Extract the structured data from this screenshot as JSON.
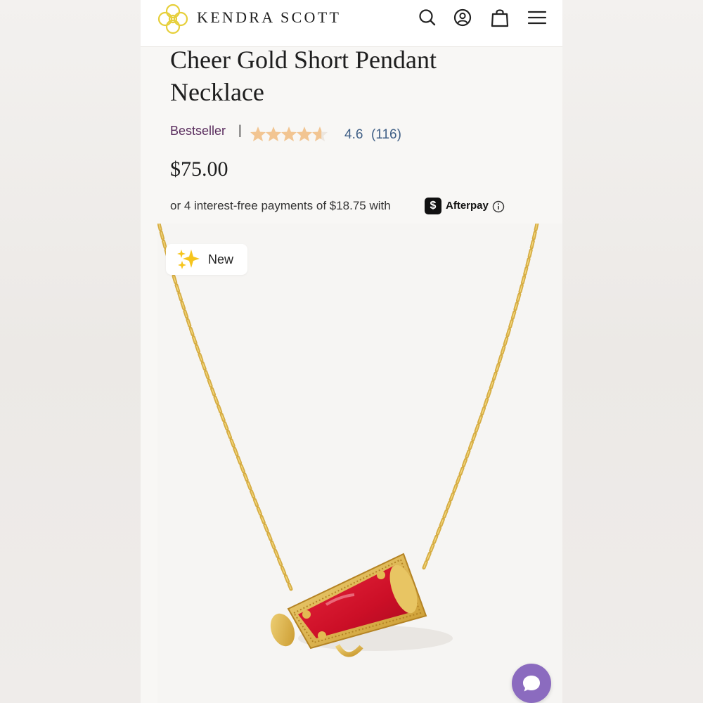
{
  "header": {
    "brand": "KENDRA SCOTT",
    "icons": [
      "search-icon",
      "account-icon",
      "shopping-bag-icon",
      "menu-icon"
    ]
  },
  "product": {
    "title": "Cheer Gold Short Pendant Necklace",
    "badge_bestseller": "Bestseller",
    "divider": "|",
    "rating": "4.6",
    "rating_value": 4.6,
    "reviews": "(116)",
    "price": "$75.00",
    "installments_text": "or 4 interest-free payments of $18.75 with",
    "afterpay_badge": "$",
    "afterpay_label": "Afterpay",
    "new_badge": "New"
  },
  "colors": {
    "brand_gold": "#e6cf3a",
    "bestseller": "#5a2d5e",
    "rating": "#3f5f86",
    "star": "#f2c592",
    "chat": "#8b6bbf",
    "pendant_red": "#d3122a",
    "gold": "#d9b24a"
  }
}
